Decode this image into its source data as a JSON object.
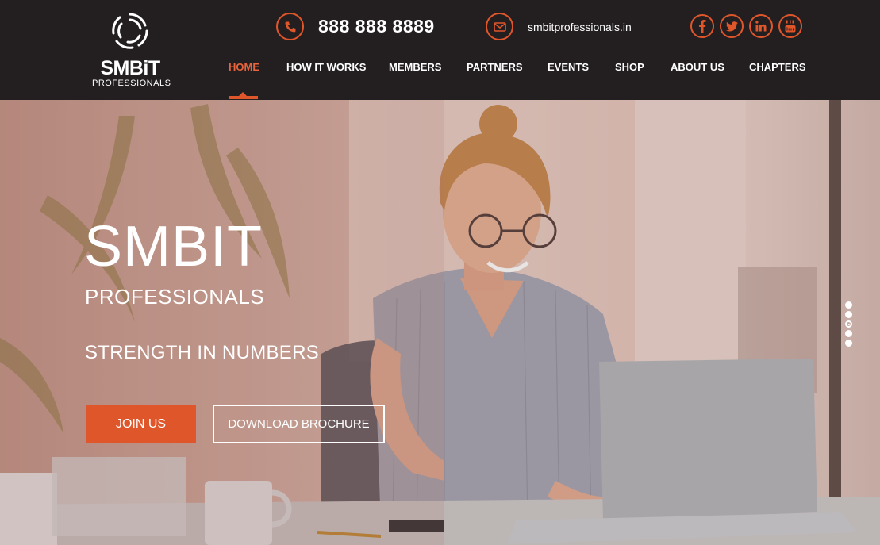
{
  "logo": {
    "brand": "SMBiT",
    "sub": "PROFESSIONALS"
  },
  "contact": {
    "phone": "888 888 8889",
    "email": "smbitprofessionals.in"
  },
  "socials": [
    {
      "name": "facebook",
      "glyph": "f"
    },
    {
      "name": "twitter",
      "glyph": "t"
    },
    {
      "name": "linkedin",
      "glyph": "in"
    },
    {
      "name": "youtube",
      "glyph": "yt"
    }
  ],
  "nav": [
    {
      "label": "HOME",
      "active": true
    },
    {
      "label": "HOW IT WORKS"
    },
    {
      "label": "MEMBERS"
    },
    {
      "label": "PARTNERS"
    },
    {
      "label": "EVENTS"
    },
    {
      "label": "SHOP"
    },
    {
      "label": "ABOUT US"
    },
    {
      "label": "CHAPTERS"
    }
  ],
  "hero": {
    "title": "SMBIT",
    "subtitle": "PROFESSIONALS",
    "tagline": "STRENGTH IN NUMBERS",
    "join_label": "JOIN US",
    "brochure_label": "DOWNLOAD BROCHURE"
  },
  "slider": {
    "count": 5,
    "active_index": 2
  },
  "colors": {
    "accent": "#e0562b",
    "header_bg": "#231f20"
  }
}
